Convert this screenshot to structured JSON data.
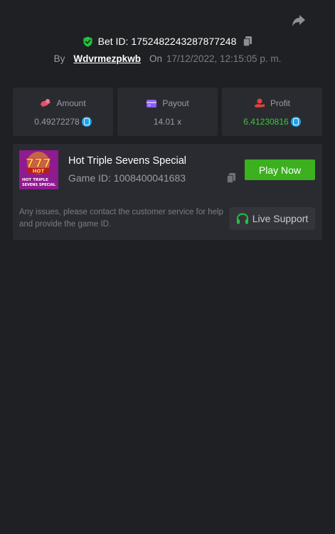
{
  "header": {
    "bet_label": "Bet ID:",
    "bet_id": "1752482243287877248",
    "by_label": "By",
    "username": "Wdvrmezpkwb",
    "on_label": "On",
    "date": "17/12/2022, 12:15:05 p. m."
  },
  "stats": [
    {
      "label": "Amount",
      "value": "0.49272278",
      "icon": "amount-icon",
      "color": "#e84d6c",
      "has_coin": true
    },
    {
      "label": "Payout",
      "value": "14.01 x",
      "icon": "wallet-icon",
      "color": "#8a5cf6",
      "has_coin": false
    },
    {
      "label": "Profit",
      "value": "6.41230816",
      "icon": "profit-icon",
      "color": "#e2403e",
      "value_color": "#3ec43e",
      "has_coin": true
    }
  ],
  "game": {
    "title": "Hot Triple Sevens Special",
    "id_label": "Game ID:",
    "id": "1008400041683",
    "play_label": "Play Now",
    "thumb_text_1": "HOT",
    "thumb_text_2": "HOT TRIPLE",
    "thumb_text_3": "SEVENS SPECIAL",
    "thumb_digit": "777"
  },
  "support": {
    "notice": "Any issues, please contact the customer service for help and provide the game ID.",
    "button_label": "Live Support"
  },
  "colors": {
    "background": "#1f2023",
    "card": "#2a2b30",
    "play_button": "#3cb01f",
    "profit_green": "#3ec43e",
    "coin_blue": "#1aa3ea",
    "shield_green": "#21c33c"
  }
}
